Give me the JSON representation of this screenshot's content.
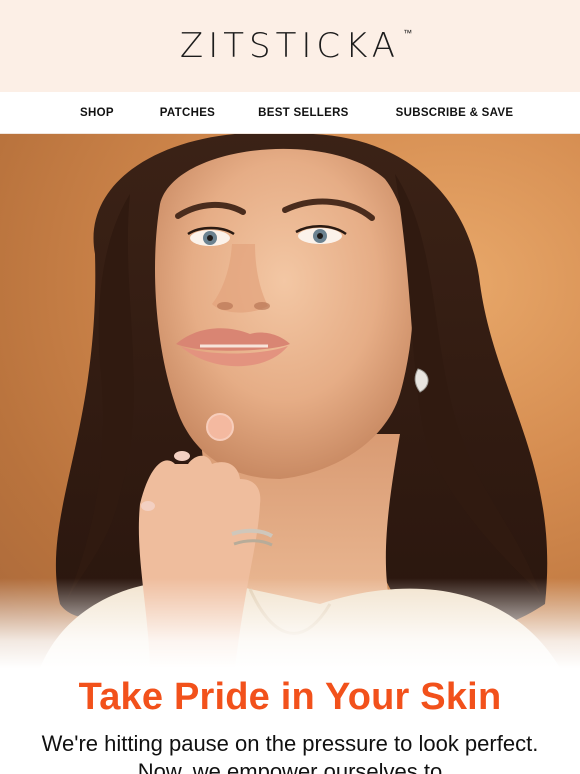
{
  "brand": {
    "logo_text": "ZITSTICKA",
    "trademark": "™",
    "header_bg": "#fcefe6"
  },
  "nav": {
    "items": [
      {
        "label": "SHOP"
      },
      {
        "label": "PATCHES"
      },
      {
        "label": "BEST SELLERS"
      },
      {
        "label": "SUBSCRIBE & SAVE"
      }
    ]
  },
  "hero": {
    "background_color": "#d48b4f",
    "icon": "portrait-photo"
  },
  "main": {
    "headline": "Take Pride in Your Skin",
    "headline_color": "#f2511b",
    "body": "We're hitting pause on the pressure to look perfect. Now, we empower ourselves to"
  }
}
